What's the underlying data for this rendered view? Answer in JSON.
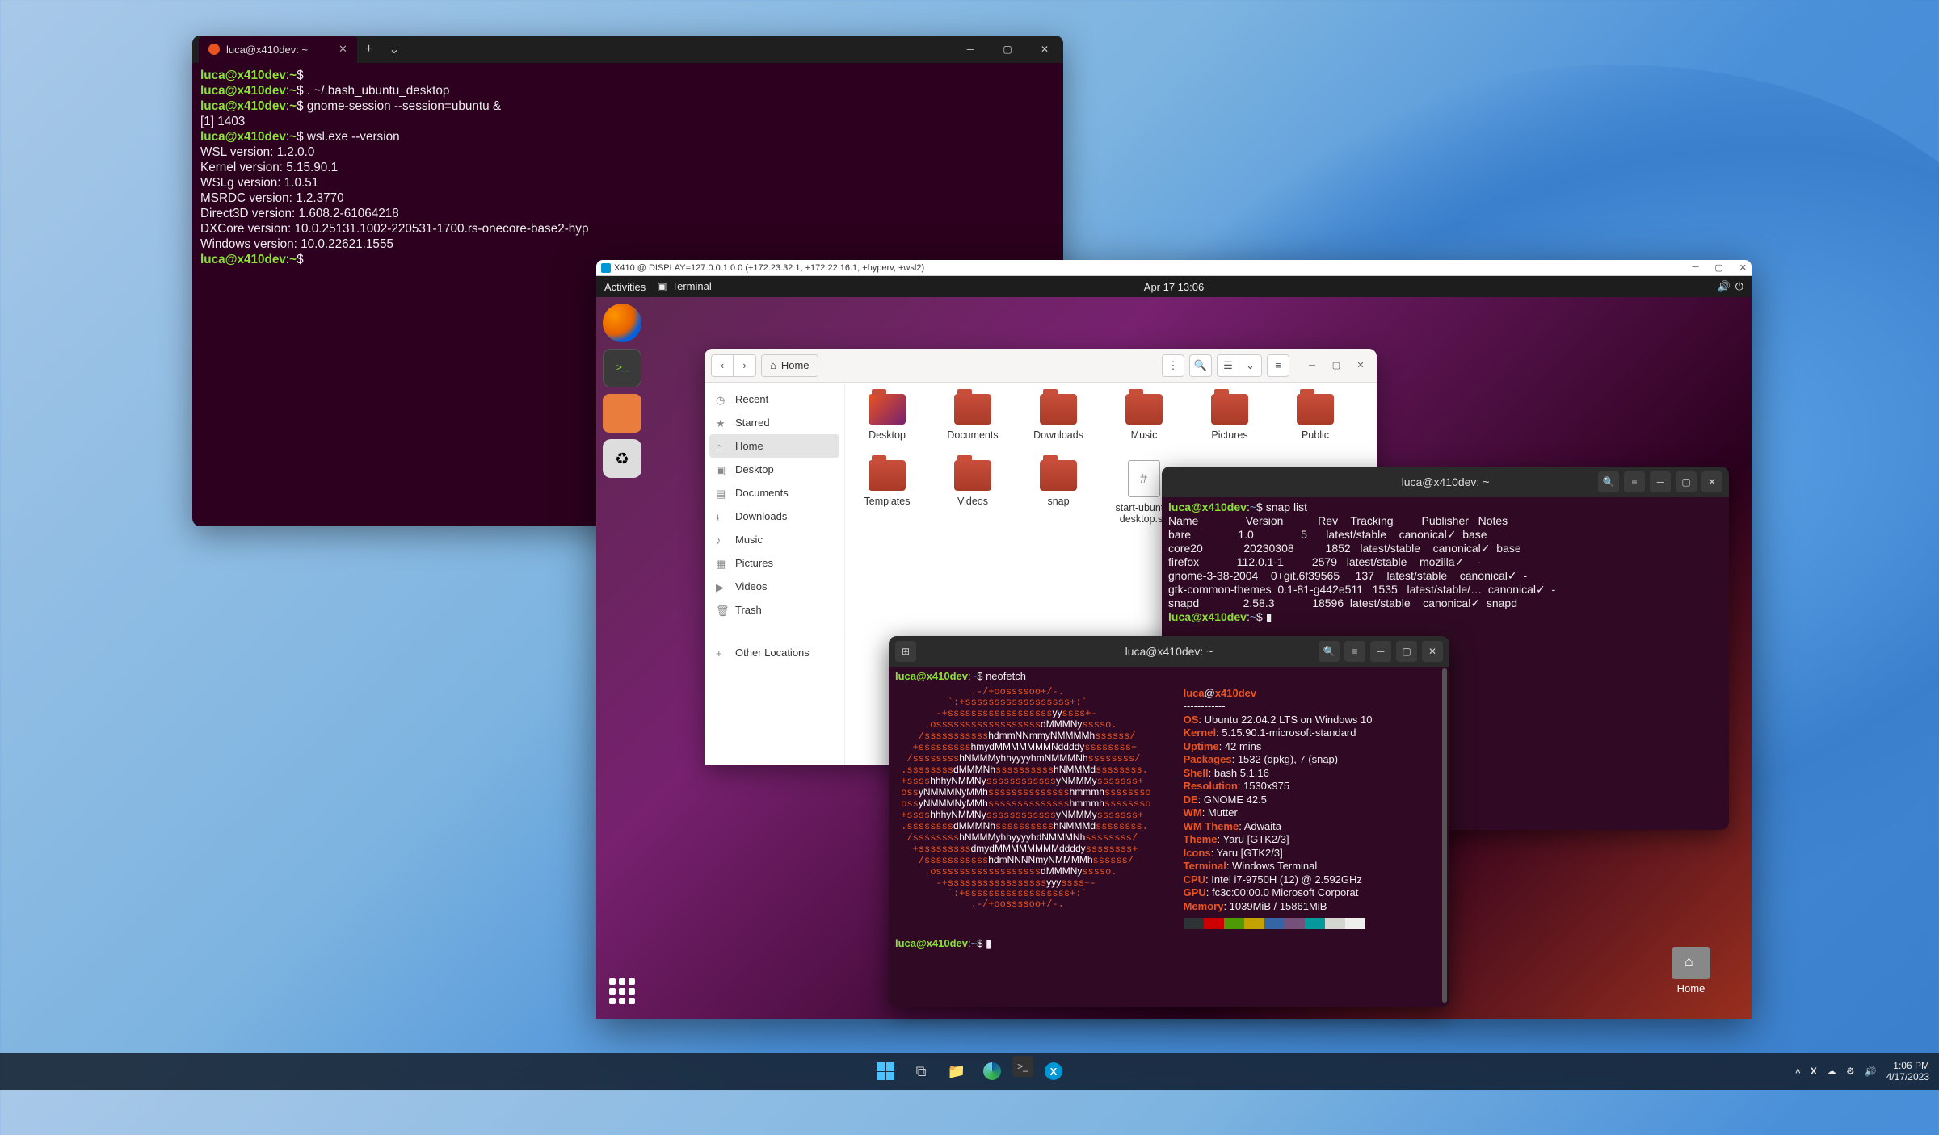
{
  "winterm": {
    "tab_title": "luca@x410dev: ~",
    "lines": [
      {
        "p": "luca@x410dev",
        "c": ":",
        "d": "~",
        "s": "$ "
      },
      {
        "p": "luca@x410dev",
        "c": ":",
        "d": "~",
        "s": "$ . ~/.bash_ubuntu_desktop"
      },
      {
        "p": "luca@x410dev",
        "c": ":",
        "d": "~",
        "s": "$ gnome-session --session=ubuntu &"
      },
      {
        "t": "[1] 1403"
      },
      {
        "p": "luca@x410dev",
        "c": ":",
        "d": "~",
        "s": "$ wsl.exe --version"
      },
      {
        "t": "WSL version: 1.2.0.0"
      },
      {
        "t": "Kernel version: 5.15.90.1"
      },
      {
        "t": "WSLg version: 1.0.51"
      },
      {
        "t": "MSRDC version: 1.2.3770"
      },
      {
        "t": "Direct3D version: 1.608.2-61064218"
      },
      {
        "t": "DXCore version: 10.0.25131.1002-220531-1700.rs-onecore-base2-hyp"
      },
      {
        "t": "Windows version: 10.0.22621.1555"
      },
      {
        "p": "luca@x410dev",
        "c": ":",
        "d": "~",
        "s": "$ "
      }
    ]
  },
  "x410": {
    "title": "X410 @ DISPLAY=127.0.0.1:0.0 (+172.23.32.1, +172.22.16.1, +hyperv, +wsl2)",
    "gnome_activities": "Activities",
    "gnome_terminal": "Terminal",
    "gnome_clock": "Apr 17  13:06",
    "desktop_home": "Home"
  },
  "nautilus": {
    "path_label": "Home",
    "sidebar": [
      "Recent",
      "Starred",
      "Home",
      "Desktop",
      "Documents",
      "Downloads",
      "Music",
      "Pictures",
      "Videos",
      "Trash",
      "Other Locations"
    ],
    "sidebar_icons": [
      "◷",
      "★",
      "⌂",
      "▣",
      "▤",
      "⭳",
      "♪",
      "▦",
      "▶",
      "🗑",
      "+"
    ],
    "active_sidebar": 2,
    "folders": [
      "Desktop",
      "Documents",
      "Downloads",
      "Music",
      "Pictures",
      "Public",
      "Templates",
      "Videos",
      "snap"
    ],
    "files": [
      "start-ubuntu-desktop.sh"
    ]
  },
  "snapterm": {
    "title": "luca@x410dev: ~",
    "prompt": "luca@x410dev",
    "cmd": "snap list",
    "headers": [
      "Name",
      "Version",
      "Rev",
      "Tracking",
      "Publisher",
      "Notes"
    ],
    "rows": [
      [
        "bare",
        "1.0",
        "5",
        "latest/stable",
        "canonical✓",
        "base"
      ],
      [
        "core20",
        "20230308",
        "1852",
        "latest/stable",
        "canonical✓",
        "base"
      ],
      [
        "firefox",
        "112.0.1-1",
        "2579",
        "latest/stable",
        "mozilla✓",
        "-"
      ],
      [
        "gnome-3-38-2004",
        "0+git.6f39565",
        "137",
        "latest/stable",
        "canonical✓",
        "-"
      ],
      [
        "gtk-common-themes",
        "0.1-81-g442e511",
        "1535",
        "latest/stable/…",
        "canonical✓",
        "-"
      ],
      [
        "snapd",
        "2.58.3",
        "18596",
        "latest/stable",
        "canonical✓",
        "snapd"
      ]
    ]
  },
  "neoterm": {
    "title": "luca@x410dev: ~",
    "prompt": "luca@x410dev",
    "cmd": "neofetch",
    "host": "luca@x410dev",
    "info": [
      [
        "OS",
        "Ubuntu 22.04.2 LTS on Windows 10"
      ],
      [
        "Kernel",
        "5.15.90.1-microsoft-standard"
      ],
      [
        "Uptime",
        "42 mins"
      ],
      [
        "Packages",
        "1532 (dpkg), 7 (snap)"
      ],
      [
        "Shell",
        "bash 5.1.16"
      ],
      [
        "Resolution",
        "1530x975"
      ],
      [
        "DE",
        "GNOME 42.5"
      ],
      [
        "WM",
        "Mutter"
      ],
      [
        "WM Theme",
        "Adwaita"
      ],
      [
        "Theme",
        "Yaru [GTK2/3]"
      ],
      [
        "Icons",
        "Yaru [GTK2/3]"
      ],
      [
        "Terminal",
        "Windows Terminal"
      ],
      [
        "CPU",
        "Intel i7-9750H (12) @ 2.592GHz"
      ],
      [
        "GPU",
        "fc3c:00:00.0 Microsoft Corporat"
      ],
      [
        "Memory",
        "1039MiB / 15861MiB"
      ]
    ],
    "palette": [
      "#2e3436",
      "#cc0000",
      "#4e9a06",
      "#c4a000",
      "#3465a4",
      "#75507b",
      "#06989a",
      "#d3d7cf",
      "#eeeeec"
    ]
  },
  "taskbar": {
    "time": "1:06 PM",
    "date": "4/17/2023"
  }
}
